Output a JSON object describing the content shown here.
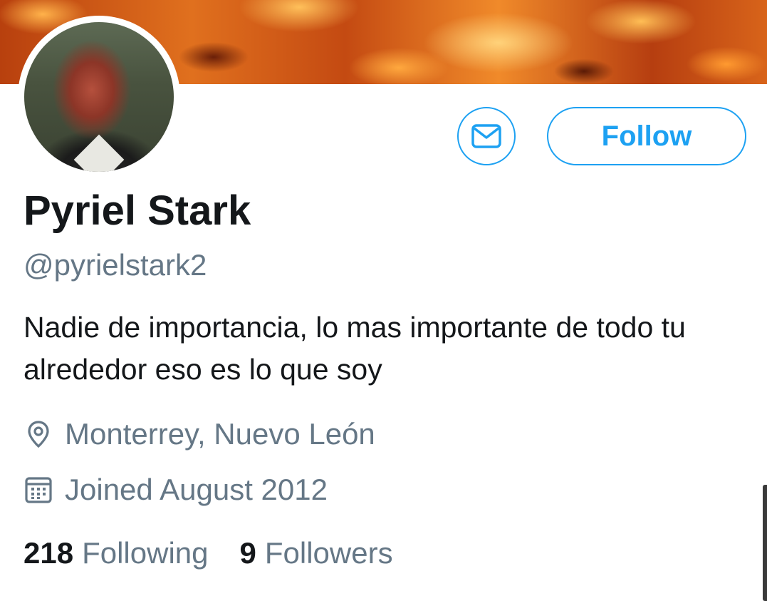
{
  "profile": {
    "name": "Pyriel Stark",
    "handle": "@pyrielstark2",
    "bio": "Nadie de importancia, lo mas importante de todo tu alrededor eso es lo que soy",
    "location": "Monterrey, Nuevo León",
    "joined": "Joined August 2012"
  },
  "actions": {
    "follow_label": "Follow",
    "message_icon": "envelope-icon"
  },
  "stats": {
    "following_count": "218",
    "following_label": "Following",
    "followers_count": "9",
    "followers_label": "Followers"
  },
  "icons": {
    "location": "map-pin-icon",
    "joined": "calendar-icon"
  },
  "colors": {
    "accent": "#1da1f2",
    "text_primary": "#14171a",
    "text_secondary": "#657786"
  }
}
